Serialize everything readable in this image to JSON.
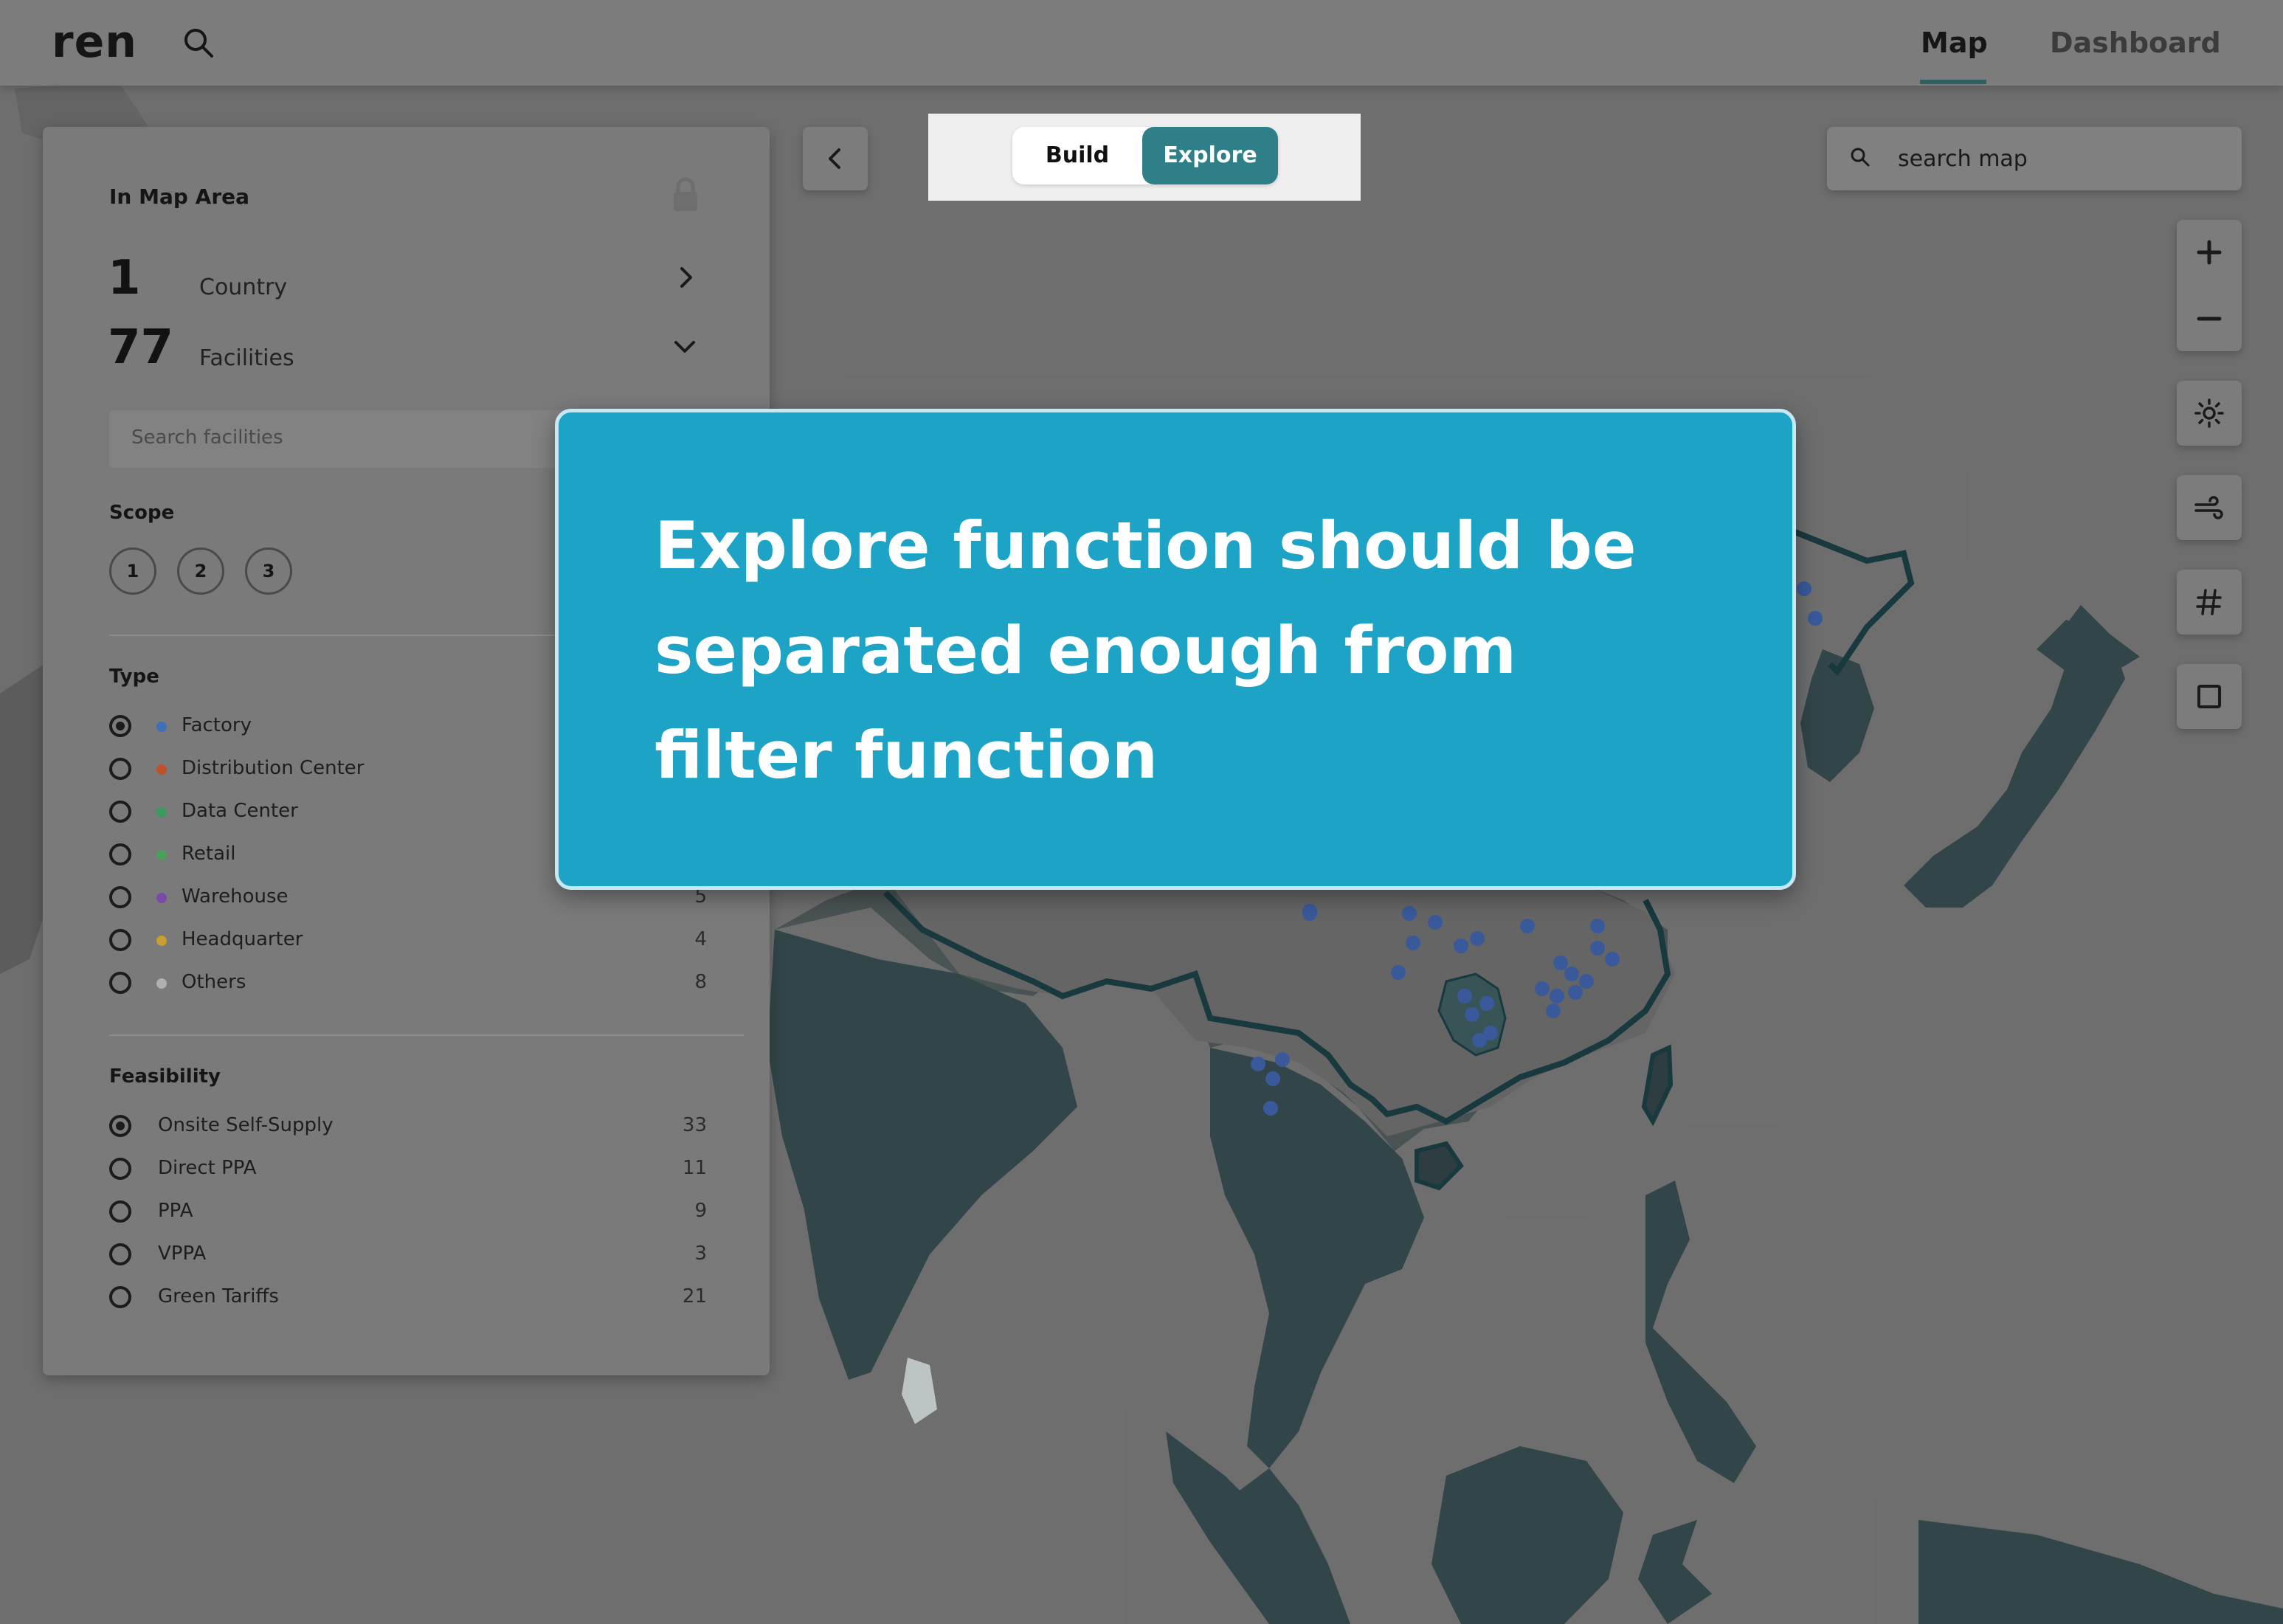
{
  "app": {
    "logo": "ren"
  },
  "nav": {
    "tabs": [
      {
        "label": "Map",
        "active": true
      },
      {
        "label": "Dashboard",
        "active": false
      }
    ]
  },
  "mode_toggle": {
    "build_label": "Build",
    "explore_label": "Explore",
    "selected": "Explore"
  },
  "map_search": {
    "placeholder": "search map"
  },
  "panel": {
    "title": "In Map Area",
    "summary": [
      {
        "value": "1",
        "label": "Country"
      },
      {
        "value": "77",
        "label": "Facilities"
      }
    ],
    "facility_search_placeholder": "Search facilities",
    "scope": {
      "title": "Scope",
      "options": [
        "1",
        "2",
        "3"
      ]
    },
    "type": {
      "title": "Type",
      "items": [
        {
          "label": "Factory",
          "count": "",
          "color": "#3f6fb8",
          "selected": true
        },
        {
          "label": "Distribution Center",
          "count": "",
          "color": "#c0502a",
          "selected": false
        },
        {
          "label": "Data Center",
          "count": "",
          "color": "#3c9a5f",
          "selected": false
        },
        {
          "label": "Retail",
          "count": "",
          "color": "#4aa05a",
          "selected": false
        },
        {
          "label": "Warehouse",
          "count": "5",
          "color": "#7a4aa8",
          "selected": false
        },
        {
          "label": "Headquarter",
          "count": "4",
          "color": "#c8a030",
          "selected": false
        },
        {
          "label": "Others",
          "count": "8",
          "color": "#b0b0b0",
          "selected": false
        }
      ]
    },
    "feasibility": {
      "title": "Feasibility",
      "items": [
        {
          "label": "Onsite Self-Supply",
          "count": "33",
          "selected": true
        },
        {
          "label": "Direct PPA",
          "count": "11",
          "selected": false
        },
        {
          "label": "PPA",
          "count": "9",
          "selected": false
        },
        {
          "label": "VPPA",
          "count": "3",
          "selected": false
        },
        {
          "label": "Green Tariffs",
          "count": "21",
          "selected": false
        }
      ]
    }
  },
  "callout": {
    "text": "Explore function should be separated enough from filter function"
  },
  "colors": {
    "accent": "#2f7f88",
    "callout_bg": "#1da3c6",
    "land": "#34494c",
    "outline": "#173b40",
    "facility_dot": "#3c5fa8"
  },
  "tools": [
    "zoom-in-icon",
    "zoom-out-icon",
    "sun-icon",
    "wind-icon",
    "hash-icon",
    "square-icon"
  ]
}
